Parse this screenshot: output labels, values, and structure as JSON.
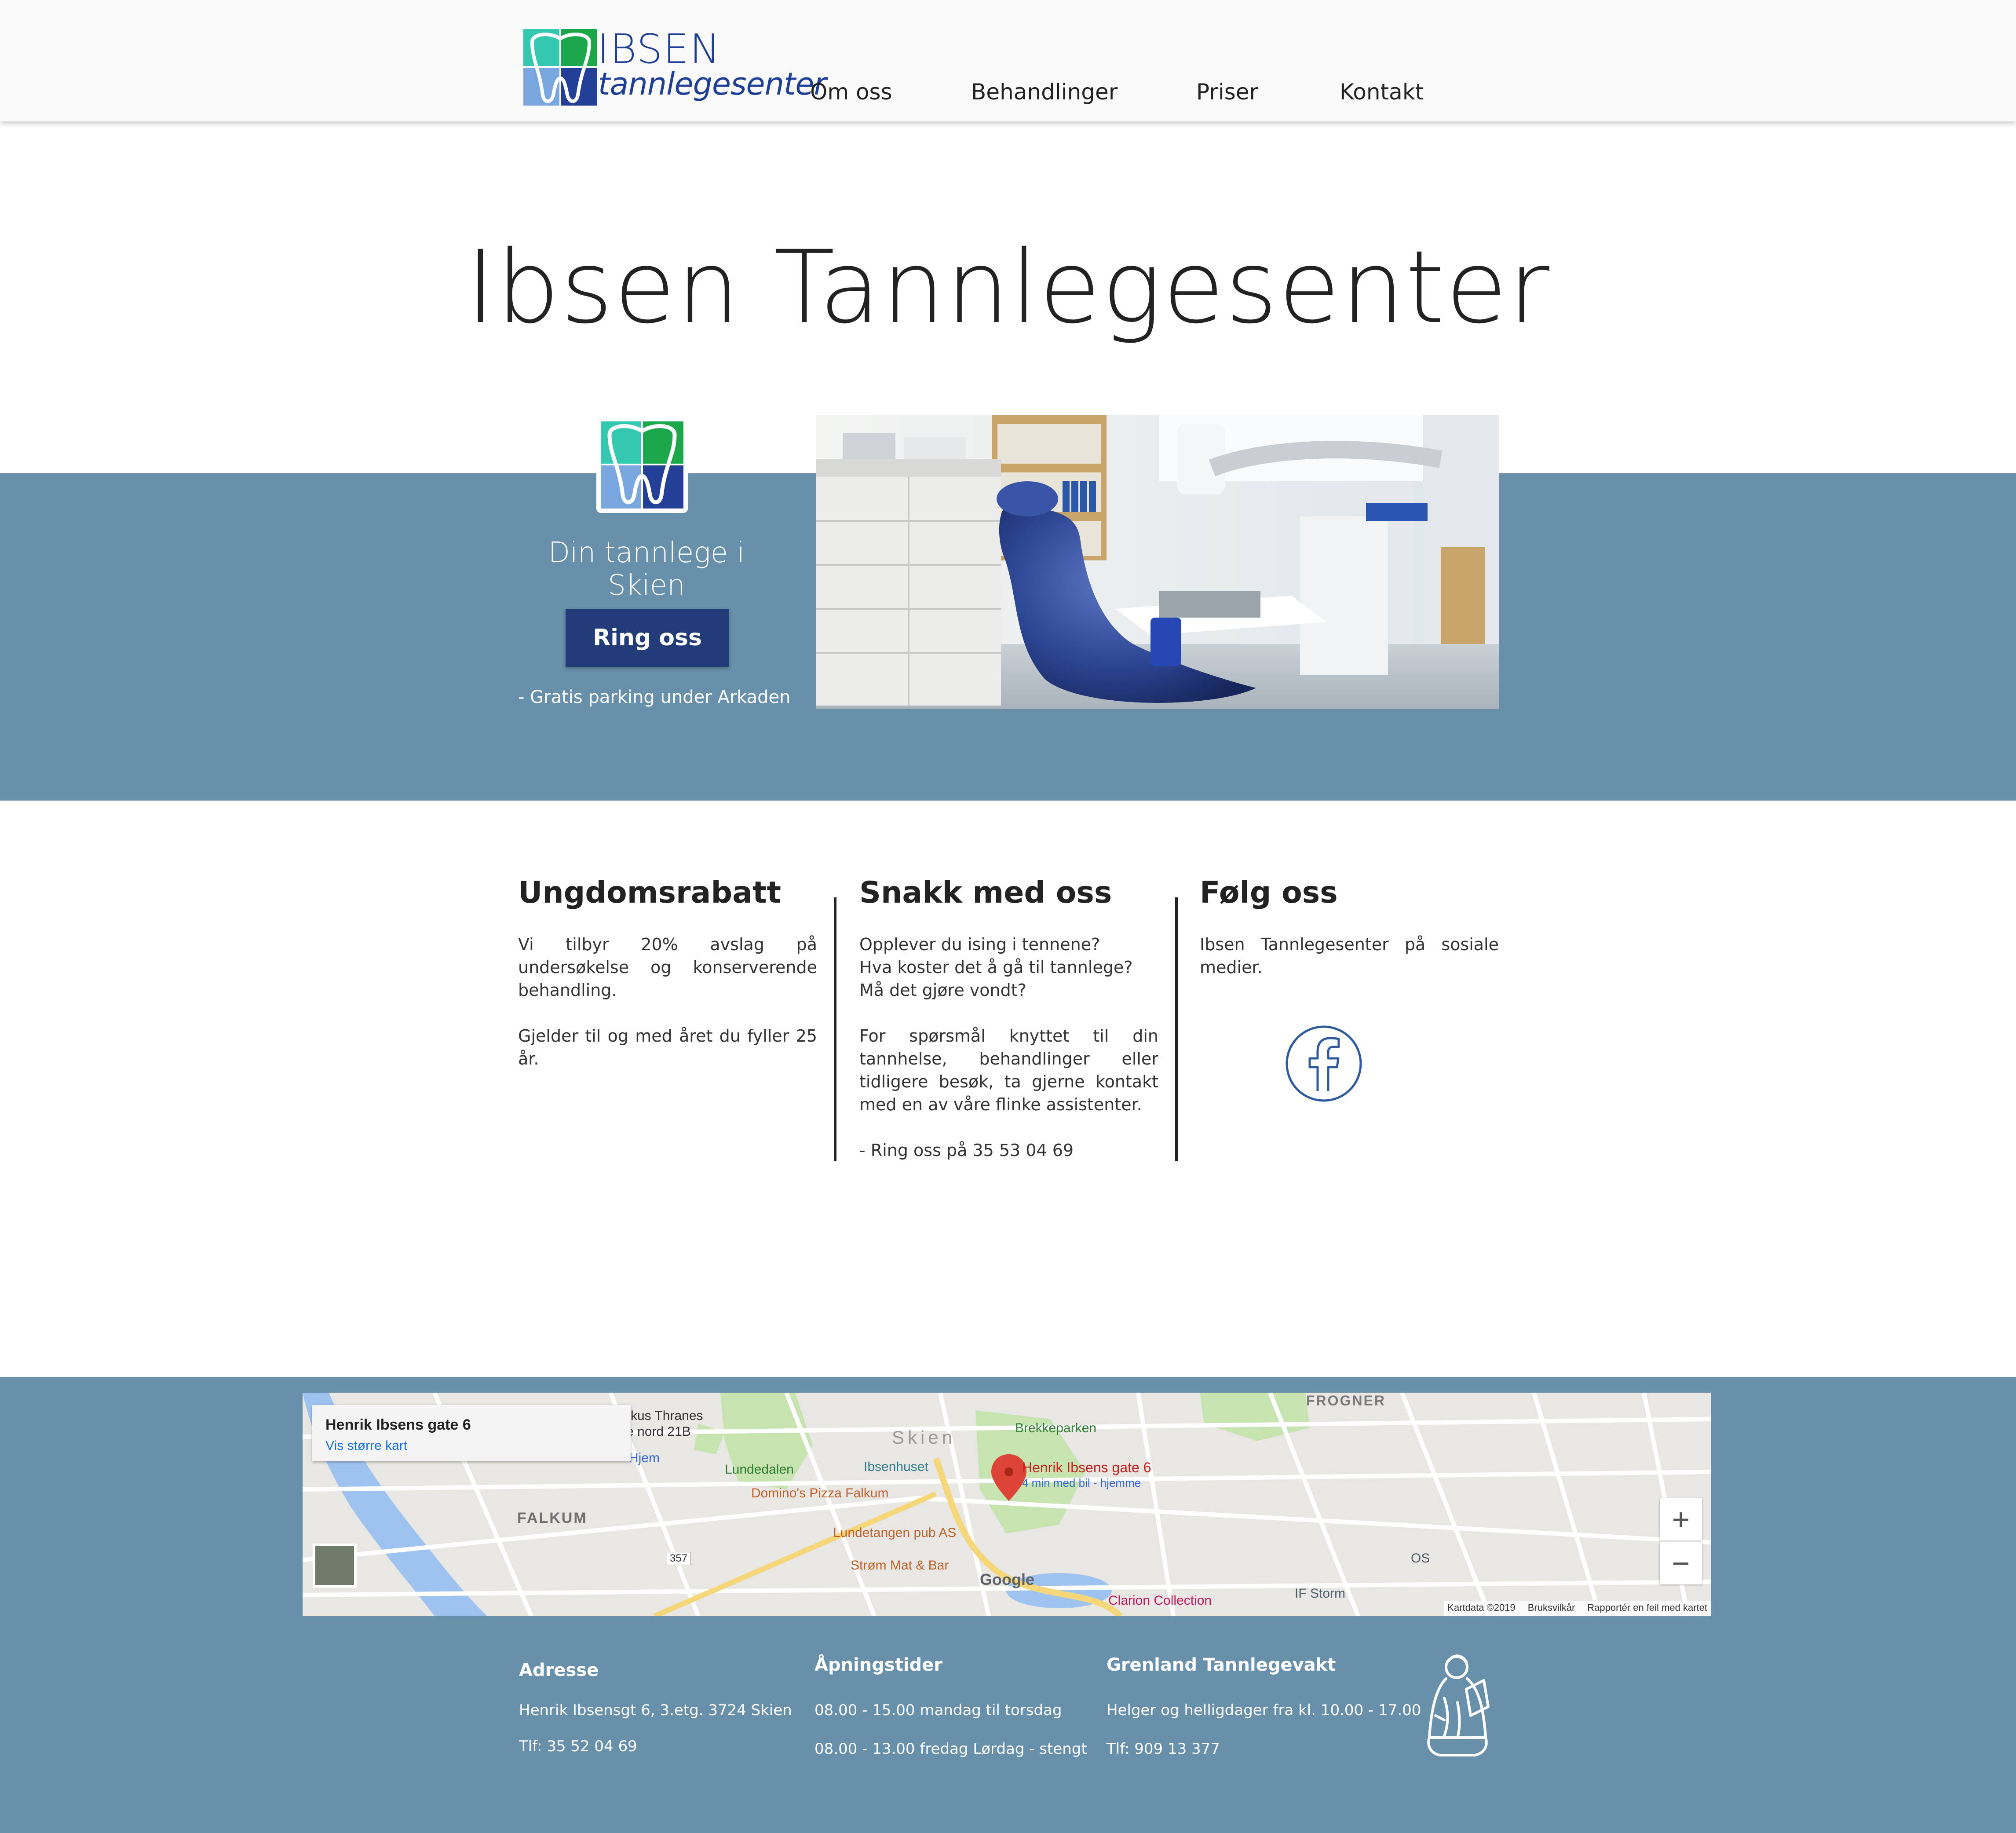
{
  "header": {
    "logo_line1": "IBSEN",
    "logo_line2": "tannlegesenter",
    "nav": [
      "Om oss",
      "Behandlinger",
      "Priser",
      "Kontakt"
    ]
  },
  "hero": {
    "title": "Ibsen Tannlegesenter",
    "tagline": "Din tannlege i Skien",
    "call_button": "Ring oss",
    "parking_note": "- Gratis parking under Arkaden"
  },
  "columns": [
    {
      "heading": "Ungdomsrabatt",
      "p1": "Vi tilbyr 20% avslag på undersøkelse og konserverende behandling.",
      "p2": "Gjelder til og med året du fyller 25 år."
    },
    {
      "heading": "Snakk med oss",
      "p1_line1": "Opplever du ising i tennene?",
      "p1_line2": "Hva koster det å gå til tannlege?",
      "p1_line3": "Må det gjøre vondt?",
      "p2": "For spørsmål knyttet til din tannhelse, behandlinger eller tidligere besøk, ta gjerne kontakt med en av våre flinke assistenter.",
      "p3": "- Ring oss på 35 53 04 69"
    },
    {
      "heading": "Følg oss",
      "p1": "Ibsen Tannlegesenter på sosiale medier."
    }
  ],
  "map": {
    "card_title": "Henrik Ibsens gate 6",
    "card_link": "Vis større kart",
    "marker_title": "Henrik Ibsens gate 6",
    "marker_sub": "4 min med bil - hjemme",
    "places": {
      "frogner": "FROGNER",
      "skien": "Skien",
      "falkum": "FALKUM",
      "brekkeparken": "Brekkeparken",
      "lundedalen": "Lundedalen",
      "ibsenhuset": "Ibsenhuset",
      "dominos": "Domino's Pizza Falkum",
      "lundetangen": "Lundetangen pub AS",
      "strom": "Strøm Mat & Bar",
      "clarion": "Clarion Collection",
      "ifstorm": "IF Storm",
      "os": "OS",
      "hjem": "Hjem",
      "markus": "rkus Thranes",
      "markus2": "e nord 21B",
      "road": "357",
      "google": "Google"
    },
    "attribution": "Kartdata ©2019",
    "terms": "Bruksvilkår",
    "report": "Rapportér en feil med kartet",
    "zoom_in": "+",
    "zoom_out": "−"
  },
  "footer": {
    "address_head": "Adresse",
    "address": "Henrik Ibsensgt 6, 3.etg.  3724 Skien",
    "phone": "Tlf: 35 52 04 69",
    "hours_head": "Åpningstider",
    "hours1": "08.00 - 15.00 mandag til torsdag",
    "hours2": "08.00 - 13.00 fredag  Lørdag - stengt",
    "emergency_head": "Grenland Tannlegevakt",
    "emergency_hours": "Helger og helligdager fra kl. 10.00 - 17.00",
    "emergency_phone": "Tlf: 909 13 377"
  },
  "colors": {
    "brand_blue": "#1f3f96",
    "band_blue": "#6890ab",
    "button_blue": "#213c78",
    "logo_green": "#1aa84b",
    "logo_teal": "#33c9b0",
    "logo_lightblue": "#7aa6e0",
    "logo_navy": "#233f97"
  },
  "icons": [
    "tooth-logo-icon",
    "facebook-icon",
    "map-pin-icon",
    "ibsen-statue-icon"
  ]
}
